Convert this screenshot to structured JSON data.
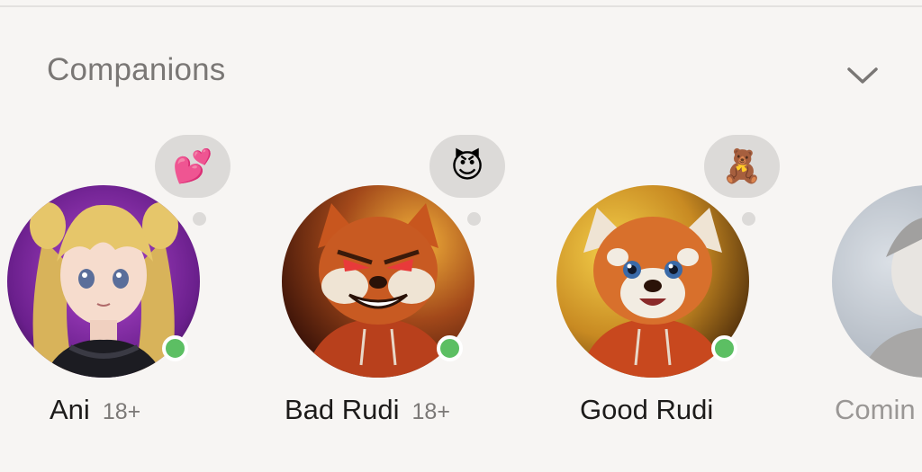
{
  "section": {
    "title": "Companions",
    "collapse_icon": "chevron-down-icon"
  },
  "companions": [
    {
      "name": "Ani",
      "badge": "18+",
      "mood_emoji": "💕",
      "mood_icon": "two-hearts-icon",
      "status": "online",
      "colors": {
        "background": "#7a2fa0",
        "accent": "#e6c66a"
      }
    },
    {
      "name": "Bad Rudi",
      "badge": "18+",
      "mood_emoji": "😈",
      "mood_icon": "smiling-devil-icon",
      "status": "online",
      "colors": {
        "background": "#8a3a12",
        "accent": "#c85a2a"
      }
    },
    {
      "name": "Good Rudi",
      "badge": "",
      "mood_emoji": "🧸",
      "mood_icon": "teddy-bear-icon",
      "status": "online",
      "colors": {
        "background": "#c9a12a",
        "accent": "#d06a34"
      }
    },
    {
      "name": "Comin",
      "badge": "",
      "mood_emoji": "",
      "status": "",
      "colors": {
        "background": "#7f8f9f",
        "accent": "#b8c2cc"
      }
    }
  ],
  "status_color": "#5cbf63"
}
